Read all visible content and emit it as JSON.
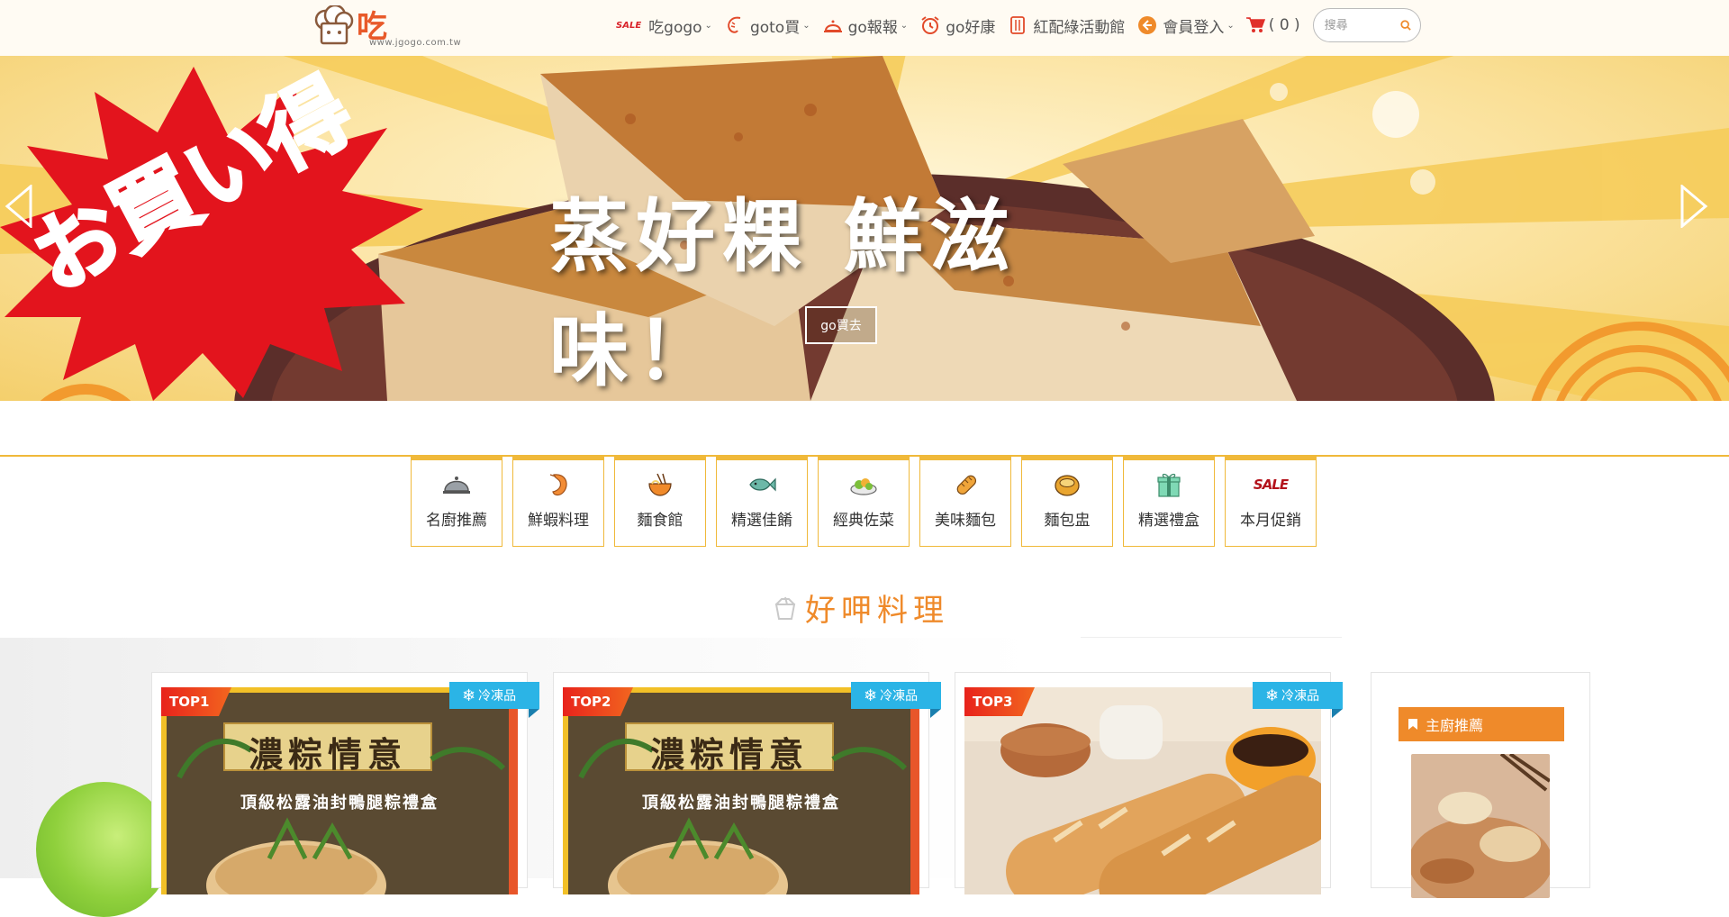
{
  "header": {
    "logo_text": "吃gogo",
    "logo_url": "www.jgogo.com.tw",
    "nav": [
      {
        "label": "吃gogo",
        "badge": "SALE"
      },
      {
        "label": "goto買"
      },
      {
        "label": "go報報"
      },
      {
        "label": "go好康"
      },
      {
        "label": "紅配綠活動館"
      },
      {
        "label": "會員登入"
      }
    ],
    "cart_count": "( 0 )",
    "search_placeholder": "搜尋"
  },
  "banner": {
    "sticker_text": "お買い得",
    "title": "蒸好粿 鮮滋味！",
    "button_label": "go買去"
  },
  "categories": [
    {
      "label": "名廚推薦",
      "icon": "cloche-icon"
    },
    {
      "label": "鮮蝦料理",
      "icon": "shrimp-icon"
    },
    {
      "label": "麵食館",
      "icon": "noodle-bowl-icon"
    },
    {
      "label": "精選佳餚",
      "icon": "fish-icon"
    },
    {
      "label": "經典佐菜",
      "icon": "salad-plate-icon"
    },
    {
      "label": "美味麵包",
      "icon": "bread-icon"
    },
    {
      "label": "麵包盅",
      "icon": "bread-bowl-icon"
    },
    {
      "label": "精選禮盒",
      "icon": "gift-icon"
    },
    {
      "label": "本月促銷",
      "icon": "sale-icon",
      "icon_text": "SALE"
    }
  ],
  "section": {
    "title": "好呷料理"
  },
  "products": [
    {
      "rank": "TOP1",
      "tag": "冷凍品",
      "image_title": "濃粽情意",
      "image_subtitle": "頂級松露油封鴨腿粽禮盒"
    },
    {
      "rank": "TOP2",
      "tag": "冷凍品",
      "image_title": "濃粽情意",
      "image_subtitle": "頂級松露油封鴨腿粽禮盒"
    },
    {
      "rank": "TOP3",
      "tag": "冷凍品"
    }
  ],
  "sidebar": {
    "title": "主廚推薦"
  },
  "colors": {
    "accent": "#ef8a2a",
    "category_border": "#f0b93a",
    "cold_tag": "#2bb4e6",
    "top_badge": "#e8231c"
  }
}
